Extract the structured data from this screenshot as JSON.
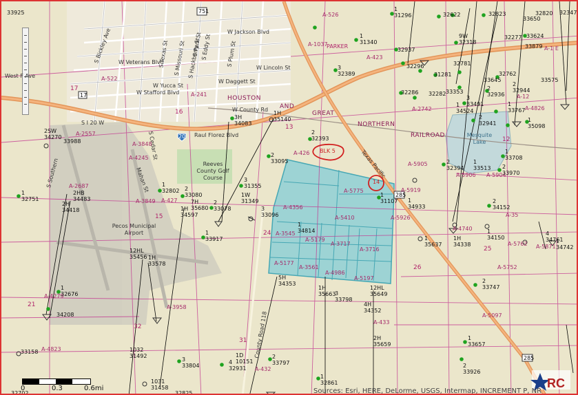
{
  "map": {
    "source_text": "Sources: Esri, HERE, DeLorme, USGS, Intermap, INCREMENT P, NR",
    "scale": {
      "zero": "0",
      "mid": "0.3",
      "end": "0.6mi"
    },
    "highlight_labels": {
      "blk5": "BLK 5",
      "sec14": "14"
    },
    "railroad_words": [
      "HOUSTON",
      "AND",
      "GREAT",
      "NORTHERN",
      "RAILROAD"
    ],
    "place_labels": [
      "Reeves County Golf Course",
      "Pecos Municipal Airport",
      "Mesquite Lake"
    ],
    "street_labels": [
      "W Jackson Blvd",
      "W Veterans Blvd",
      "W Lincoln St",
      "W Daggett St",
      "W Yucca St",
      "W Stafford Blvd",
      "W County Rd",
      "Raul Florez Blvd",
      "West F Ave",
      "S I 20 W",
      "S Bickley Ave",
      "S Texas St",
      "S Missouri St",
      "S Hackberry St",
      "S Eddy St",
      "S Plum St",
      "S Park St",
      "Mahan St",
      "S Cedar St",
      "Texas Pacific",
      "County Road 118",
      "PARKER",
      "S Southern"
    ],
    "shield_labels": [
      "17",
      "20",
      "285",
      "751"
    ],
    "section_numbers": [
      "16",
      "15",
      "17",
      "24",
      "25",
      "21",
      "31",
      "32",
      "12",
      "13",
      "26"
    ],
    "abstract_labels": [
      "A-526",
      "A-1037",
      "A-423",
      "A-522",
      "A-241",
      "A-2557",
      "A-3848",
      "A-4245",
      "A-2687",
      "A-3849",
      "A-427",
      "A-426",
      "A-5775",
      "A-4356",
      "A-5410",
      "A-3545",
      "A-5179",
      "A-3717",
      "A-3716",
      "A-5177",
      "A-3561",
      "A-4986",
      "A-5197",
      "A-5905",
      "A-5919",
      "A-5926",
      "A-2742",
      "A-4826",
      "A-5906",
      "A-5904",
      "A-4740",
      "A-5762",
      "A-5752",
      "A-3958",
      "A-433",
      "A-4823",
      "A-432",
      "A-4279",
      "A-35",
      "A-5871",
      "A-5097",
      "A-1 E",
      "A-12"
    ],
    "wells": [
      {
        "label": "33925"
      },
      {
        "label": "1\n31296"
      },
      {
        "label": "32622"
      },
      {
        "label": "32823"
      },
      {
        "label": "33650"
      },
      {
        "label": "32820"
      },
      {
        "label": "32347"
      },
      {
        "label": "1\n31340"
      },
      {
        "label": "32937"
      },
      {
        "label": "32296"
      },
      {
        "label": "3\n32389"
      },
      {
        "label": "32286"
      },
      {
        "label": "2\n32393"
      },
      {
        "label": "2SW\n34270"
      },
      {
        "label": "33988"
      },
      {
        "label": "3H\n34083"
      },
      {
        "label": "1H\n35140"
      },
      {
        "label": "2\n33095"
      },
      {
        "label": "1\n32751"
      },
      {
        "label": "2HB\n34483"
      },
      {
        "label": "2H\n34418"
      },
      {
        "label": "1\n32802"
      },
      {
        "label": "3\n31355"
      },
      {
        "label": "2\n33080"
      },
      {
        "label": "7H\n35680"
      },
      {
        "label": "1W\n31349"
      },
      {
        "label": "1H\n34597"
      },
      {
        "label": "2\n33078"
      },
      {
        "label": "3\n33096"
      },
      {
        "label": "1\n33917"
      },
      {
        "label": "12HL\n35456"
      },
      {
        "label": "1H\n33578"
      },
      {
        "label": "1\n34814"
      },
      {
        "label": "1\n31107"
      },
      {
        "label": "1\n34933"
      },
      {
        "label": "2\n32394"
      },
      {
        "label": "1\n33513"
      },
      {
        "label": "2\n33970"
      },
      {
        "label": "1\n33708"
      },
      {
        "label": "2\n34152"
      },
      {
        "label": "1\n34150"
      },
      {
        "label": "1H\n34338"
      },
      {
        "label": "1\n35637"
      },
      {
        "label": "4\n34761"
      },
      {
        "label": "1\n34742"
      },
      {
        "label": "2\n33747"
      },
      {
        "label": "5H\n34353"
      },
      {
        "label": "1H\n35663"
      },
      {
        "label": "3\n33798"
      },
      {
        "label": "12HL\n35649"
      },
      {
        "label": "4H\n34352"
      },
      {
        "label": "2H\n35659"
      },
      {
        "label": "1\n32676"
      },
      {
        "label": "34208"
      },
      {
        "label": "33158"
      },
      {
        "label": "1032\n31492"
      },
      {
        "label": "3\n33804"
      },
      {
        "label": "4\n32931"
      },
      {
        "label": "1D\n10151"
      },
      {
        "label": "2\n33797"
      },
      {
        "label": "1\n32861"
      },
      {
        "label": "1031\n31458"
      },
      {
        "label": "32825"
      },
      {
        "label": "32702"
      },
      {
        "label": "1\n33657"
      },
      {
        "label": "2\n33926"
      },
      {
        "label": "1\n35098"
      },
      {
        "label": "2\n32941"
      },
      {
        "label": "1\n33767"
      },
      {
        "label": "2\n32944"
      },
      {
        "label": "2\n32936"
      },
      {
        "label": "1\n34524"
      },
      {
        "label": "3\n33491"
      },
      {
        "label": "32282"
      },
      {
        "label": "33353"
      },
      {
        "label": "31281"
      },
      {
        "label": "32781"
      },
      {
        "label": "32762"
      },
      {
        "label": "33645"
      },
      {
        "label": "33575"
      },
      {
        "label": "9W\n32318"
      },
      {
        "label": "32277"
      },
      {
        "label": "33624"
      },
      {
        "label": "33879"
      },
      {
        "label": "33818"
      }
    ]
  }
}
